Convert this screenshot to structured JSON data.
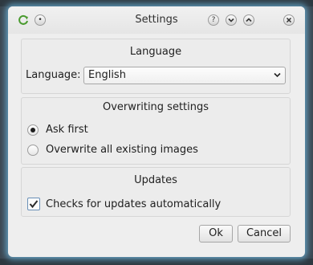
{
  "window": {
    "title": "Settings",
    "titlebar_icons": {
      "app": "reload-app-icon",
      "menu": "dot-menu-icon",
      "help": "question-icon",
      "minimize": "chevron-down-icon",
      "maximize": "chevron-up-icon",
      "close": "close-icon"
    }
  },
  "language_group": {
    "title": "Language",
    "label": "Language:",
    "selected": "English",
    "dropdown_icon": "chevron-down-icon"
  },
  "overwrite_group": {
    "title": "Overwriting settings",
    "options": [
      {
        "label": "Ask first",
        "selected": true
      },
      {
        "label": "Overwrite all existing images",
        "selected": false
      }
    ]
  },
  "updates_group": {
    "title": "Updates",
    "checkbox_label": "Checks for updates automatically",
    "checked": true
  },
  "buttons": {
    "ok": "Ok",
    "cancel": "Cancel"
  },
  "colors": {
    "glow": "#6eb9e1",
    "window_bg": "#eeeeee"
  }
}
